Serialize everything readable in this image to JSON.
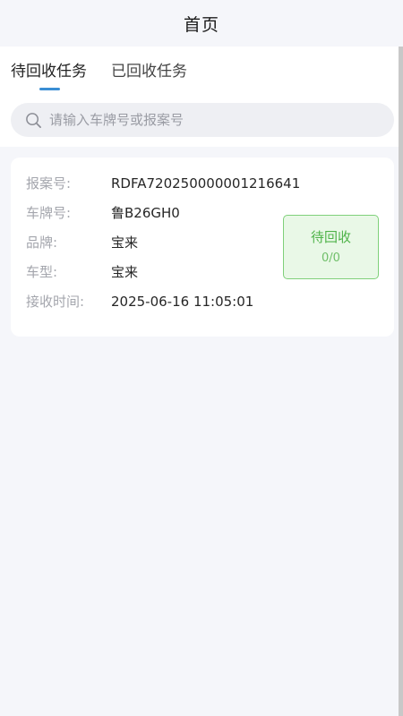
{
  "header": {
    "title": "首页"
  },
  "tabs": [
    {
      "label": "待回收任务",
      "active": true
    },
    {
      "label": "已回收任务",
      "active": false
    }
  ],
  "search": {
    "placeholder": "请输入车牌号或报案号",
    "value": ""
  },
  "tasks": [
    {
      "fields": [
        {
          "label": "报案号:",
          "value": "RDFA720250000001216641"
        },
        {
          "label": "车牌号:",
          "value": "鲁B26GH0"
        },
        {
          "label": "品牌:",
          "value": "宝来"
        },
        {
          "label": "车型:",
          "value": "宝来"
        },
        {
          "label": "接收时间:",
          "value": "2025-06-16 11:05:01"
        }
      ],
      "status": {
        "label": "待回收",
        "count": "0/0",
        "color": "#4fb349"
      }
    }
  ],
  "colors": {
    "accent": "#3a8ed4",
    "status_green": "#4fb349",
    "status_bg": "#e9f8e7",
    "page_bg": "#f5f6fa"
  }
}
